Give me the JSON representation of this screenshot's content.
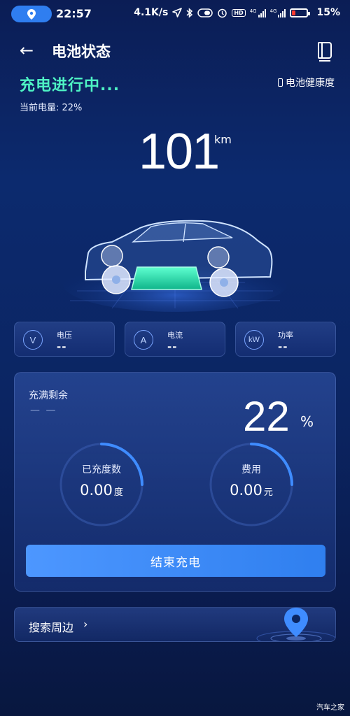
{
  "status_bar": {
    "time": "22:57",
    "net_speed": "4.1K/s",
    "hd": "HD",
    "sig1": "4G",
    "sig2": "4G",
    "battery_pct": "15%"
  },
  "header": {
    "title": "电池状态"
  },
  "charging": {
    "status": "充电进行中...",
    "current_level": "当前电量: 22%",
    "health_link": "电池健康度"
  },
  "range": {
    "value": "101",
    "unit": "km"
  },
  "metrics": [
    {
      "icon": "V",
      "label": "电压",
      "value": "--"
    },
    {
      "icon": "A",
      "label": "电流",
      "value": "--"
    },
    {
      "icon": "kW",
      "label": "功率",
      "value": "--"
    }
  ],
  "panel": {
    "full_label": "充满剩余",
    "full_value": "— —",
    "soc": "22",
    "soc_unit": "%",
    "charged": {
      "label": "已充度数",
      "value": "0.00",
      "unit": "度"
    },
    "cost": {
      "label": "费用",
      "value": "0.00",
      "unit": "元"
    },
    "end_button": "结束充电"
  },
  "search": {
    "label": "搜索周边",
    "chevron": "›"
  },
  "watermark": "汽车之家",
  "colors": {
    "accent_green": "#4ef3c4",
    "accent_blue": "#2f7fef",
    "battery_low": "#ff3b30"
  }
}
